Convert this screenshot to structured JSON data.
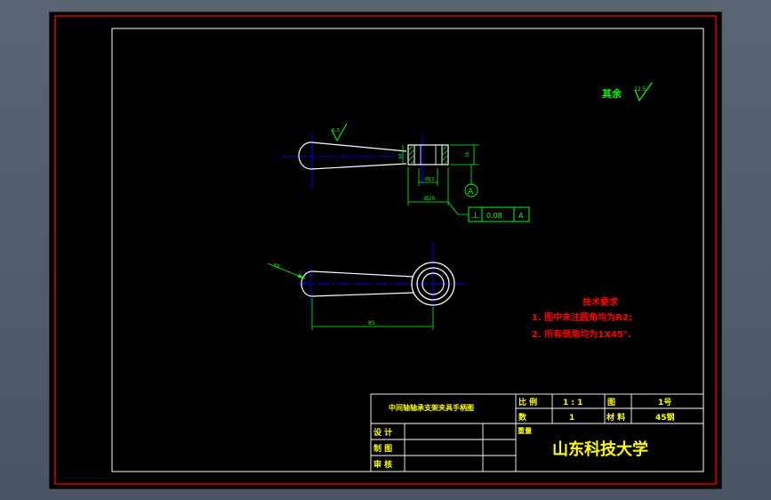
{
  "drawing": {
    "roughness_note": "其余",
    "roughness_default": "12.5",
    "roughness_handle": "6.3",
    "dim_bore_dia": "Ø20",
    "dim_height": "16",
    "dim_small": "10",
    "dim_hole": "Ø12",
    "datum_label": "A",
    "tolerance_symbol": "⊥",
    "tolerance_value": "0.08",
    "tolerance_datum": "A",
    "dim_radius": "R8",
    "dim_length": "85",
    "tech_title": "技术要求",
    "tech_items": [
      "1.  图中未注圆角均为R2;",
      "2.  所有倒角均为1X45°."
    ],
    "colors": {
      "frame": "#ff0000",
      "lines": "#ffffff",
      "dimensions": "#00ff00",
      "centerlines": "#0000ff",
      "notes": "#ff0000",
      "titlebox": "#ffff00"
    }
  },
  "title_block": {
    "part_name": "中间轴轴承支架夹具手柄图",
    "scale_label": "比  例",
    "scale_value": "1 : 1",
    "drawing_no_label": "图",
    "drawing_no_value": "1号",
    "quantity_label": "数",
    "quantity_value": "1",
    "material_label": "材  料",
    "material_value": "45钢",
    "weight_label": "重量",
    "designer_label": "设  计",
    "drafter_label": "制  图",
    "reviewer_label": "审  核",
    "school": "山东科技大学"
  }
}
